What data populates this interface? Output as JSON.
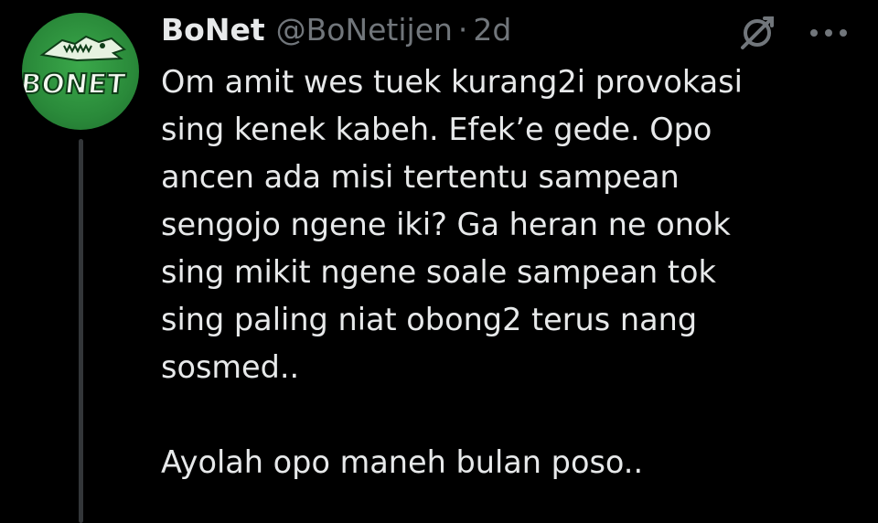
{
  "tweet": {
    "author": {
      "display_name": "BoNet",
      "handle": "@BoNetijen",
      "avatar_text": "BONET",
      "avatar_color": "#2a8a3a"
    },
    "separator": "·",
    "time": "2d",
    "icons": {
      "grok": "grok-icon",
      "more": "more-icon"
    },
    "body": {
      "paragraph_1": "Om amit wes tuek kurang2i provokasi\nsing kenek kabeh. Efek’e gede. Opo\nancen ada misi tertentu sampean\nsengojo ngene iki? Ga heran ne onok\nsing mikit ngene soale sampean tok\nsing paling niat obong2 terus nang\nsosmed..",
      "paragraph_2": "Ayolah opo maneh bulan poso.."
    }
  },
  "colors": {
    "background": "#000000",
    "text_primary": "#e7e9ea",
    "text_secondary": "#71767b",
    "thread_line": "#333639"
  }
}
